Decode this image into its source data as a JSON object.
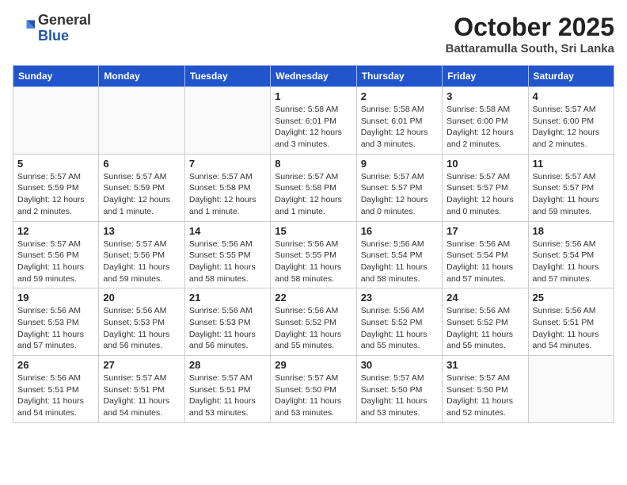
{
  "header": {
    "logo_general": "General",
    "logo_blue": "Blue",
    "title": "October 2025",
    "subtitle": "Battaramulla South, Sri Lanka"
  },
  "days_of_week": [
    "Sunday",
    "Monday",
    "Tuesday",
    "Wednesday",
    "Thursday",
    "Friday",
    "Saturday"
  ],
  "weeks": [
    [
      {
        "day": "",
        "info": ""
      },
      {
        "day": "",
        "info": ""
      },
      {
        "day": "",
        "info": ""
      },
      {
        "day": "1",
        "info": "Sunrise: 5:58 AM\nSunset: 6:01 PM\nDaylight: 12 hours\nand 3 minutes."
      },
      {
        "day": "2",
        "info": "Sunrise: 5:58 AM\nSunset: 6:01 PM\nDaylight: 12 hours\nand 3 minutes."
      },
      {
        "day": "3",
        "info": "Sunrise: 5:58 AM\nSunset: 6:00 PM\nDaylight: 12 hours\nand 2 minutes."
      },
      {
        "day": "4",
        "info": "Sunrise: 5:57 AM\nSunset: 6:00 PM\nDaylight: 12 hours\nand 2 minutes."
      }
    ],
    [
      {
        "day": "5",
        "info": "Sunrise: 5:57 AM\nSunset: 5:59 PM\nDaylight: 12 hours\nand 2 minutes."
      },
      {
        "day": "6",
        "info": "Sunrise: 5:57 AM\nSunset: 5:59 PM\nDaylight: 12 hours\nand 1 minute."
      },
      {
        "day": "7",
        "info": "Sunrise: 5:57 AM\nSunset: 5:58 PM\nDaylight: 12 hours\nand 1 minute."
      },
      {
        "day": "8",
        "info": "Sunrise: 5:57 AM\nSunset: 5:58 PM\nDaylight: 12 hours\nand 1 minute."
      },
      {
        "day": "9",
        "info": "Sunrise: 5:57 AM\nSunset: 5:57 PM\nDaylight: 12 hours\nand 0 minutes."
      },
      {
        "day": "10",
        "info": "Sunrise: 5:57 AM\nSunset: 5:57 PM\nDaylight: 12 hours\nand 0 minutes."
      },
      {
        "day": "11",
        "info": "Sunrise: 5:57 AM\nSunset: 5:57 PM\nDaylight: 11 hours\nand 59 minutes."
      }
    ],
    [
      {
        "day": "12",
        "info": "Sunrise: 5:57 AM\nSunset: 5:56 PM\nDaylight: 11 hours\nand 59 minutes."
      },
      {
        "day": "13",
        "info": "Sunrise: 5:57 AM\nSunset: 5:56 PM\nDaylight: 11 hours\nand 59 minutes."
      },
      {
        "day": "14",
        "info": "Sunrise: 5:56 AM\nSunset: 5:55 PM\nDaylight: 11 hours\nand 58 minutes."
      },
      {
        "day": "15",
        "info": "Sunrise: 5:56 AM\nSunset: 5:55 PM\nDaylight: 11 hours\nand 58 minutes."
      },
      {
        "day": "16",
        "info": "Sunrise: 5:56 AM\nSunset: 5:54 PM\nDaylight: 11 hours\nand 58 minutes."
      },
      {
        "day": "17",
        "info": "Sunrise: 5:56 AM\nSunset: 5:54 PM\nDaylight: 11 hours\nand 57 minutes."
      },
      {
        "day": "18",
        "info": "Sunrise: 5:56 AM\nSunset: 5:54 PM\nDaylight: 11 hours\nand 57 minutes."
      }
    ],
    [
      {
        "day": "19",
        "info": "Sunrise: 5:56 AM\nSunset: 5:53 PM\nDaylight: 11 hours\nand 57 minutes."
      },
      {
        "day": "20",
        "info": "Sunrise: 5:56 AM\nSunset: 5:53 PM\nDaylight: 11 hours\nand 56 minutes."
      },
      {
        "day": "21",
        "info": "Sunrise: 5:56 AM\nSunset: 5:53 PM\nDaylight: 11 hours\nand 56 minutes."
      },
      {
        "day": "22",
        "info": "Sunrise: 5:56 AM\nSunset: 5:52 PM\nDaylight: 11 hours\nand 55 minutes."
      },
      {
        "day": "23",
        "info": "Sunrise: 5:56 AM\nSunset: 5:52 PM\nDaylight: 11 hours\nand 55 minutes."
      },
      {
        "day": "24",
        "info": "Sunrise: 5:56 AM\nSunset: 5:52 PM\nDaylight: 11 hours\nand 55 minutes."
      },
      {
        "day": "25",
        "info": "Sunrise: 5:56 AM\nSunset: 5:51 PM\nDaylight: 11 hours\nand 54 minutes."
      }
    ],
    [
      {
        "day": "26",
        "info": "Sunrise: 5:56 AM\nSunset: 5:51 PM\nDaylight: 11 hours\nand 54 minutes."
      },
      {
        "day": "27",
        "info": "Sunrise: 5:57 AM\nSunset: 5:51 PM\nDaylight: 11 hours\nand 54 minutes."
      },
      {
        "day": "28",
        "info": "Sunrise: 5:57 AM\nSunset: 5:51 PM\nDaylight: 11 hours\nand 53 minutes."
      },
      {
        "day": "29",
        "info": "Sunrise: 5:57 AM\nSunset: 5:50 PM\nDaylight: 11 hours\nand 53 minutes."
      },
      {
        "day": "30",
        "info": "Sunrise: 5:57 AM\nSunset: 5:50 PM\nDaylight: 11 hours\nand 53 minutes."
      },
      {
        "day": "31",
        "info": "Sunrise: 5:57 AM\nSunset: 5:50 PM\nDaylight: 11 hours\nand 52 minutes."
      },
      {
        "day": "",
        "info": ""
      }
    ]
  ]
}
